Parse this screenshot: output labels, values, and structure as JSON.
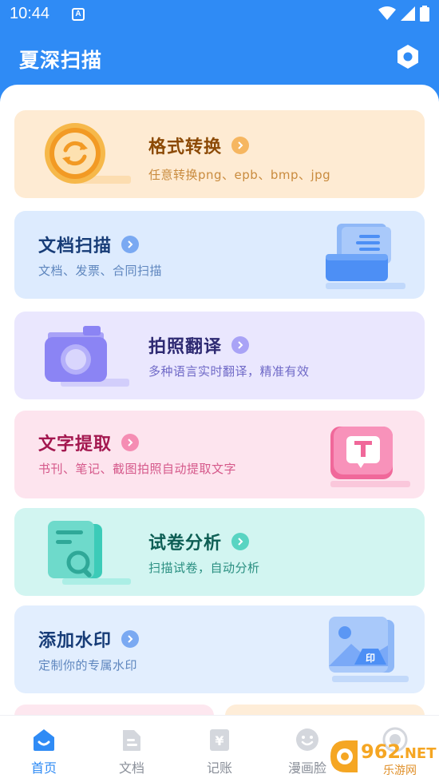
{
  "status_bar": {
    "time": "10:44",
    "notification_letter": "A"
  },
  "header": {
    "title": "夏深扫描"
  },
  "cards": [
    {
      "title": "格式转换",
      "subtitle": "任意转换png、epb、bmp、jpg"
    },
    {
      "title": "文档扫描",
      "subtitle": "文档、发票、合同扫描"
    },
    {
      "title": "拍照翻译",
      "subtitle": "多种语言实时翻译，精准有效"
    },
    {
      "title": "文字提取",
      "subtitle": "书刊、笔记、截图拍照自动提取文字"
    },
    {
      "title": "试卷分析",
      "subtitle": "扫描试卷，自动分析"
    },
    {
      "title": "添加水印",
      "subtitle": "定制你的专属水印"
    }
  ],
  "tabs": [
    {
      "label": "首页",
      "icon": "home-icon"
    },
    {
      "label": "文档",
      "icon": "document-icon"
    },
    {
      "label": "记账",
      "icon": "yen-icon"
    },
    {
      "label": "漫画脸",
      "icon": "smiley-icon"
    },
    {
      "label": "",
      "icon": "profile-icon"
    }
  ],
  "watermark": {
    "brand": "962",
    "suffix": ".NET",
    "caption": "乐游网"
  },
  "colors": {
    "primary": "#2F8BF5",
    "orange": "#F2A33A",
    "blue": "#4D8FF5",
    "purple": "#8B84F4",
    "pink": "#F0689A",
    "teal": "#3CCBB8"
  }
}
